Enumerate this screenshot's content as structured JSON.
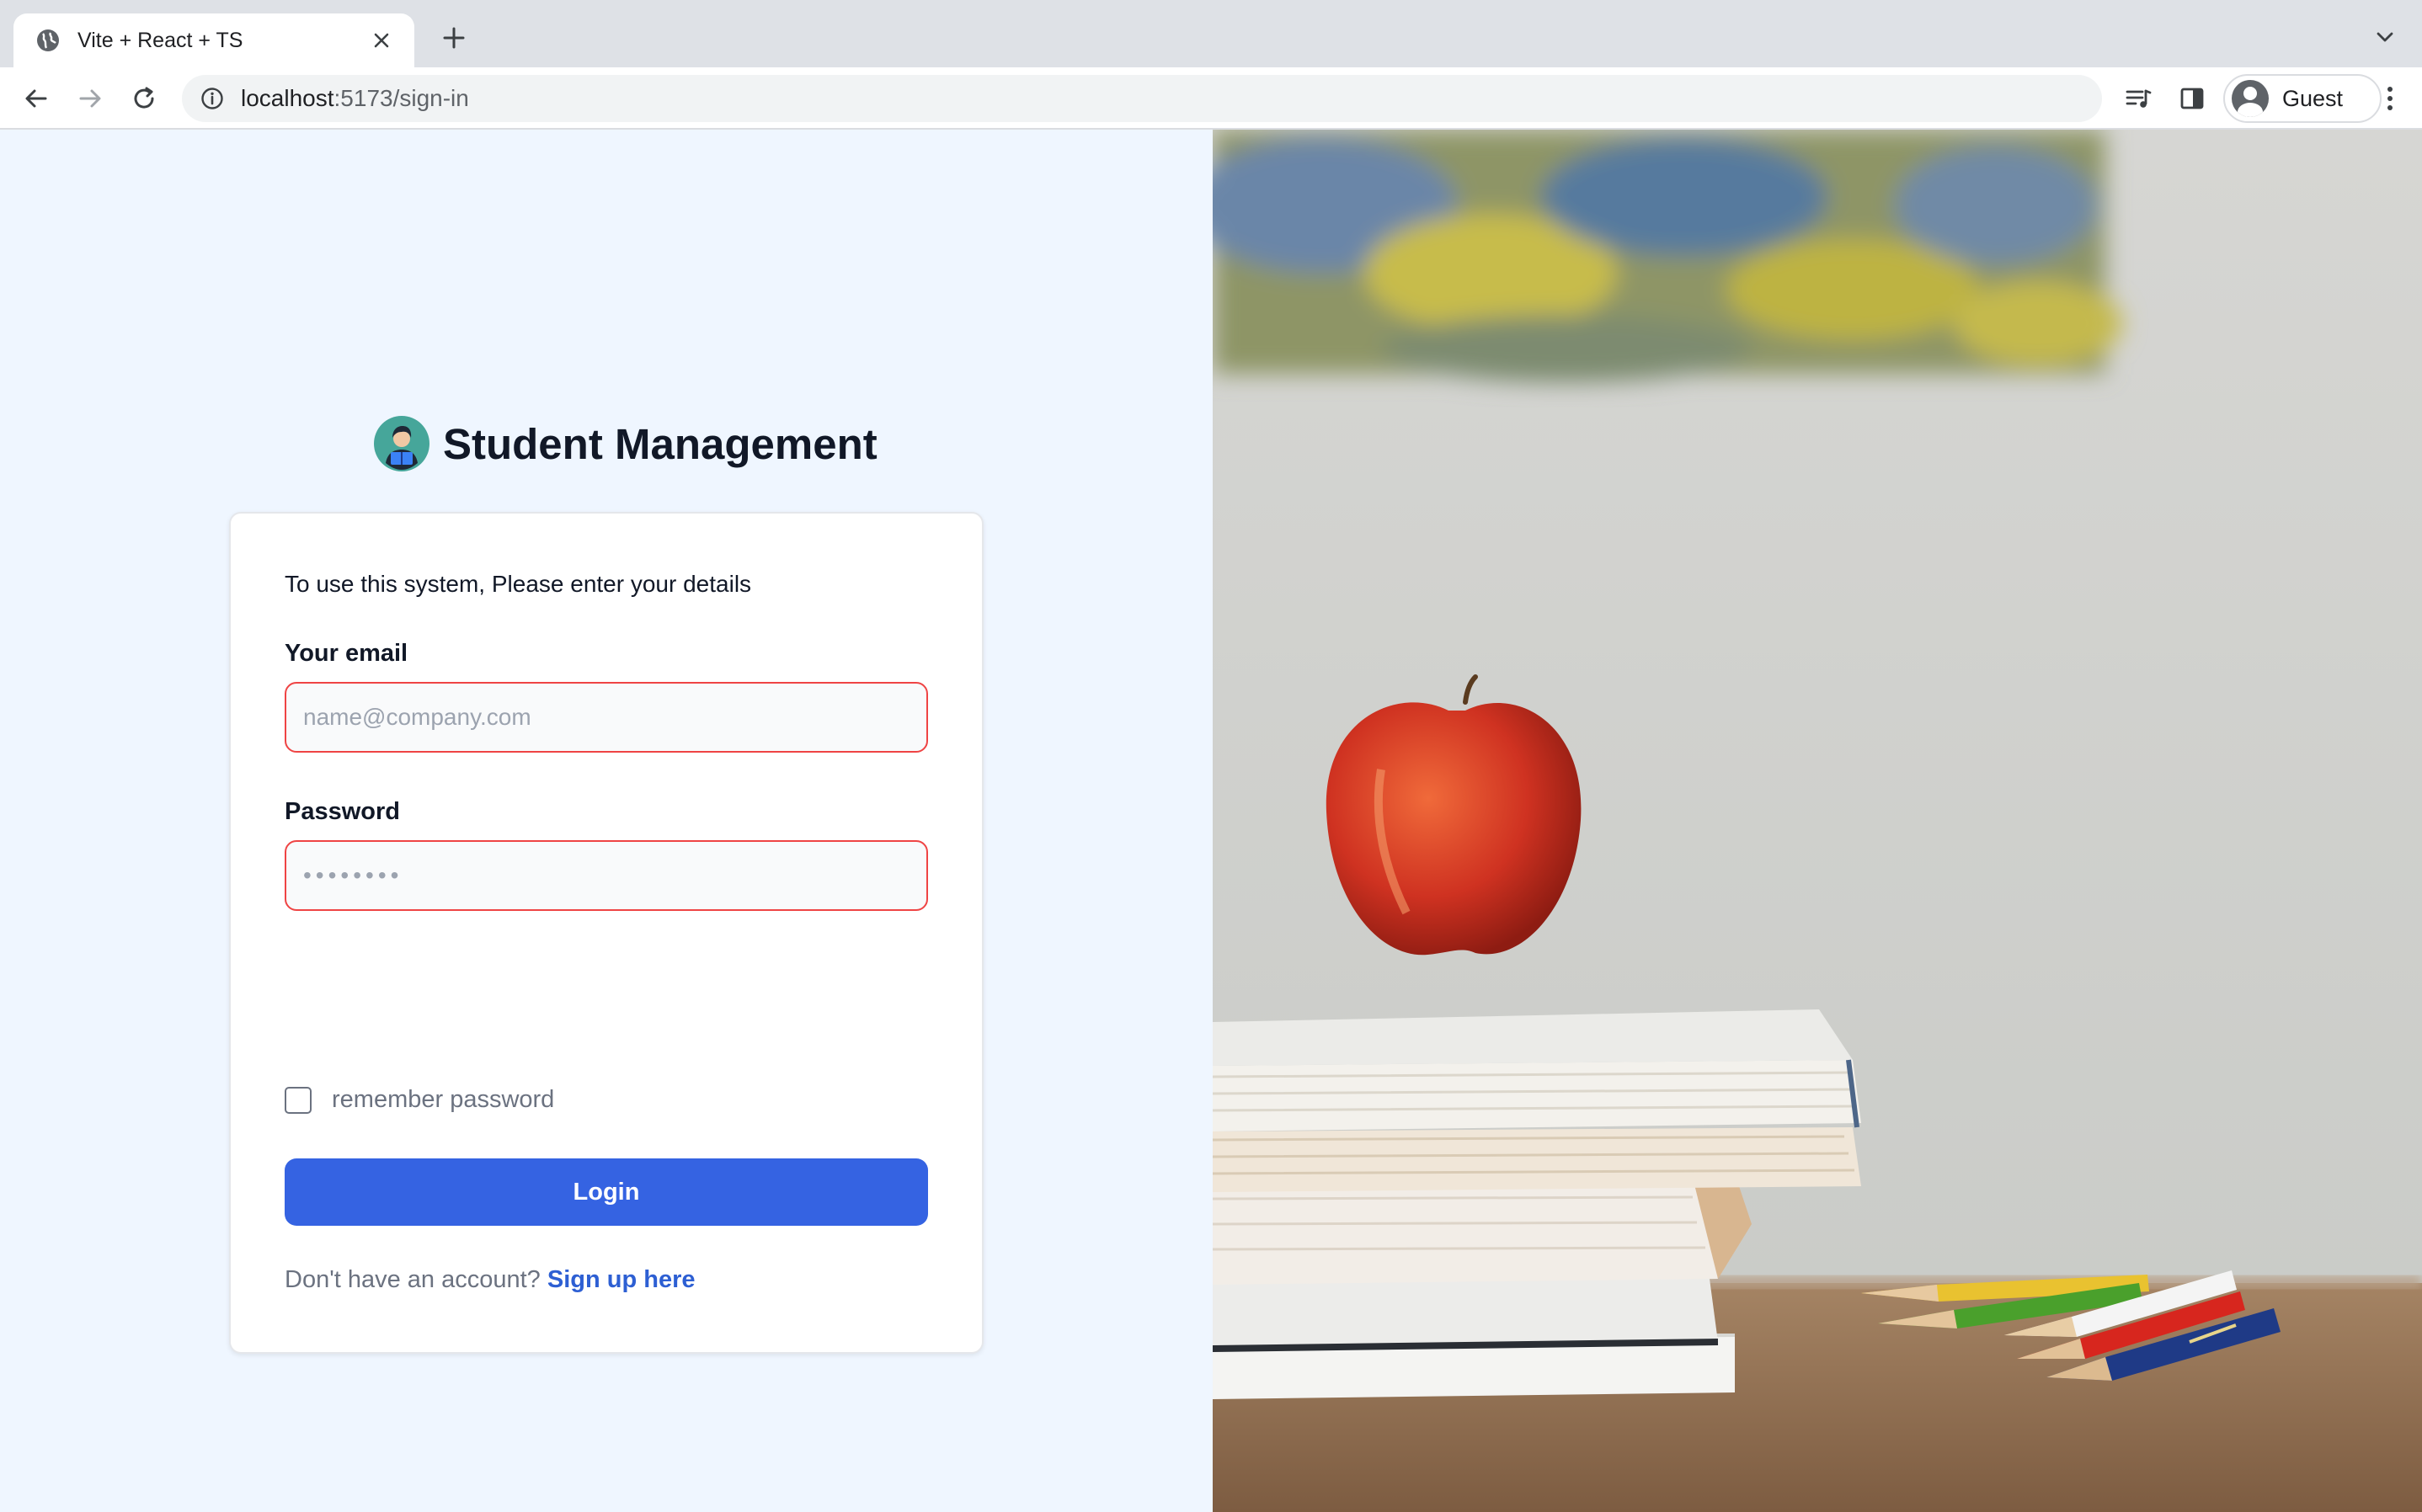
{
  "browser": {
    "tab": {
      "title": "Vite + React + TS"
    },
    "url": {
      "host": "localhost",
      "path": ":5173/sign-in"
    },
    "profile": {
      "name": "Guest"
    }
  },
  "page": {
    "brand": {
      "title": "Student Management"
    },
    "form": {
      "intro": "To use this system, Please enter your details",
      "email_label": "Your email",
      "email_placeholder": "name@company.com",
      "email_value": "",
      "password_label": "Password",
      "password_placeholder": "••••••••",
      "password_value": "",
      "remember_label": "remember password",
      "remember_checked": false,
      "login_label": "Login",
      "signup_prompt": "Don't have an account?",
      "signup_link": "Sign up here"
    }
  },
  "colors": {
    "primary": "#3563e2",
    "link": "#2d5fd3",
    "error_border": "#ef4444",
    "left_background": "#eff6ff"
  },
  "icons": [
    "globe-icon",
    "close-icon",
    "plus-icon",
    "chevron-down-icon",
    "back-arrow-icon",
    "forward-arrow-icon",
    "reload-icon",
    "info-icon",
    "media-controls-icon",
    "side-panel-icon",
    "avatar-icon",
    "kebab-menu-icon",
    "student-reading-logo"
  ]
}
